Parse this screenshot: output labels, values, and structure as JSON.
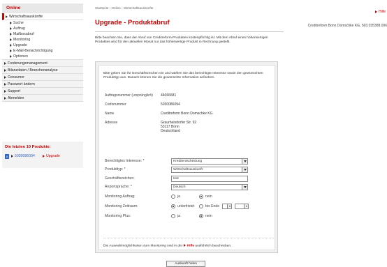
{
  "sidebar": {
    "title": "Online",
    "active_item": "Wirtschaftsauskünfte",
    "sub_items": [
      "Suche",
      "Auftrag",
      "Mailboxabruf",
      "Monitoring",
      "Upgrade",
      "E-Mail-Benachrichtigung",
      "Optionen"
    ],
    "items": [
      "Forderungsmanagement",
      "Bilanzdaten / Branchenanalyse",
      "Consumer",
      "Passwort ändern",
      "Support",
      "Abmelden"
    ]
  },
  "last10": {
    "title": "Die letzten 10 Produkte:",
    "icon_label": "A",
    "number": "5030086094",
    "link": "Upgrade"
  },
  "header": {
    "breadcrumb": "Startseite › Online › Wirtschaftsauskünfte",
    "help": "Hilfe",
    "title": "Upgrade - Produktabruf",
    "company": "Creditreform Bonn Domschke KG, 503.035388.006"
  },
  "note": "Bitte beachten Sie, dass der Abruf von Creditreform-Produkten kostenpflichtig ist. Mit dem Abruf eines höherwertigen Produktes wird für den aktuellen Monat nur das höherwertige Produkt in Rechnung gestellt.",
  "intro": "Bitte geben Sie Ihr Geschäftszeichen ein und wählen Sie das berechtigte Interesse sowie den gewünschten Produkttyp aus. Danach können Sie die gewünschte Information anfordern.",
  "details": {
    "order_label": "Auftragsnummer (ursprünglich)",
    "order_value": "44066681",
    "crefo_label": "Crefonummer",
    "crefo_value": "5030086094",
    "name_label": "Name",
    "name_value": "Creditreform Bonn Domschke KG",
    "address_label": "Adresse",
    "address_line1": "Graurheindorfer Str. 92",
    "address_line2": "53117 Bonn",
    "address_line3": "Deutschland"
  },
  "form": {
    "interest_label": "Berechtigtes Interesse: *",
    "interest_value": "Kreditentscheidung",
    "product_label": "Produkttyp: *",
    "product_value": "Wirtschaftsauskunft",
    "reference_label": "Geschäftszeichen:",
    "reference_value": "test",
    "language_label": "Reportsprache: *",
    "language_value": "Deutsch",
    "monitoring_label": "Monitoring Auftrag:",
    "monitoring_yes": "ja",
    "monitoring_no": "nein",
    "period_label": "Monitoring Zeitraum:",
    "period_unlimited": "unbefristet",
    "period_until": "bis Ende",
    "plus_label": "Monitoring Plus:",
    "plus_yes": "ja",
    "plus_no": "nein"
  },
  "footer": {
    "text_before": "Die Auswahlmöglichkeiten zum Monitoring sind in der",
    "link": "Hilfe",
    "text_after": "ausführlich beschrieben."
  },
  "submit_label": "Auskunft holen"
}
